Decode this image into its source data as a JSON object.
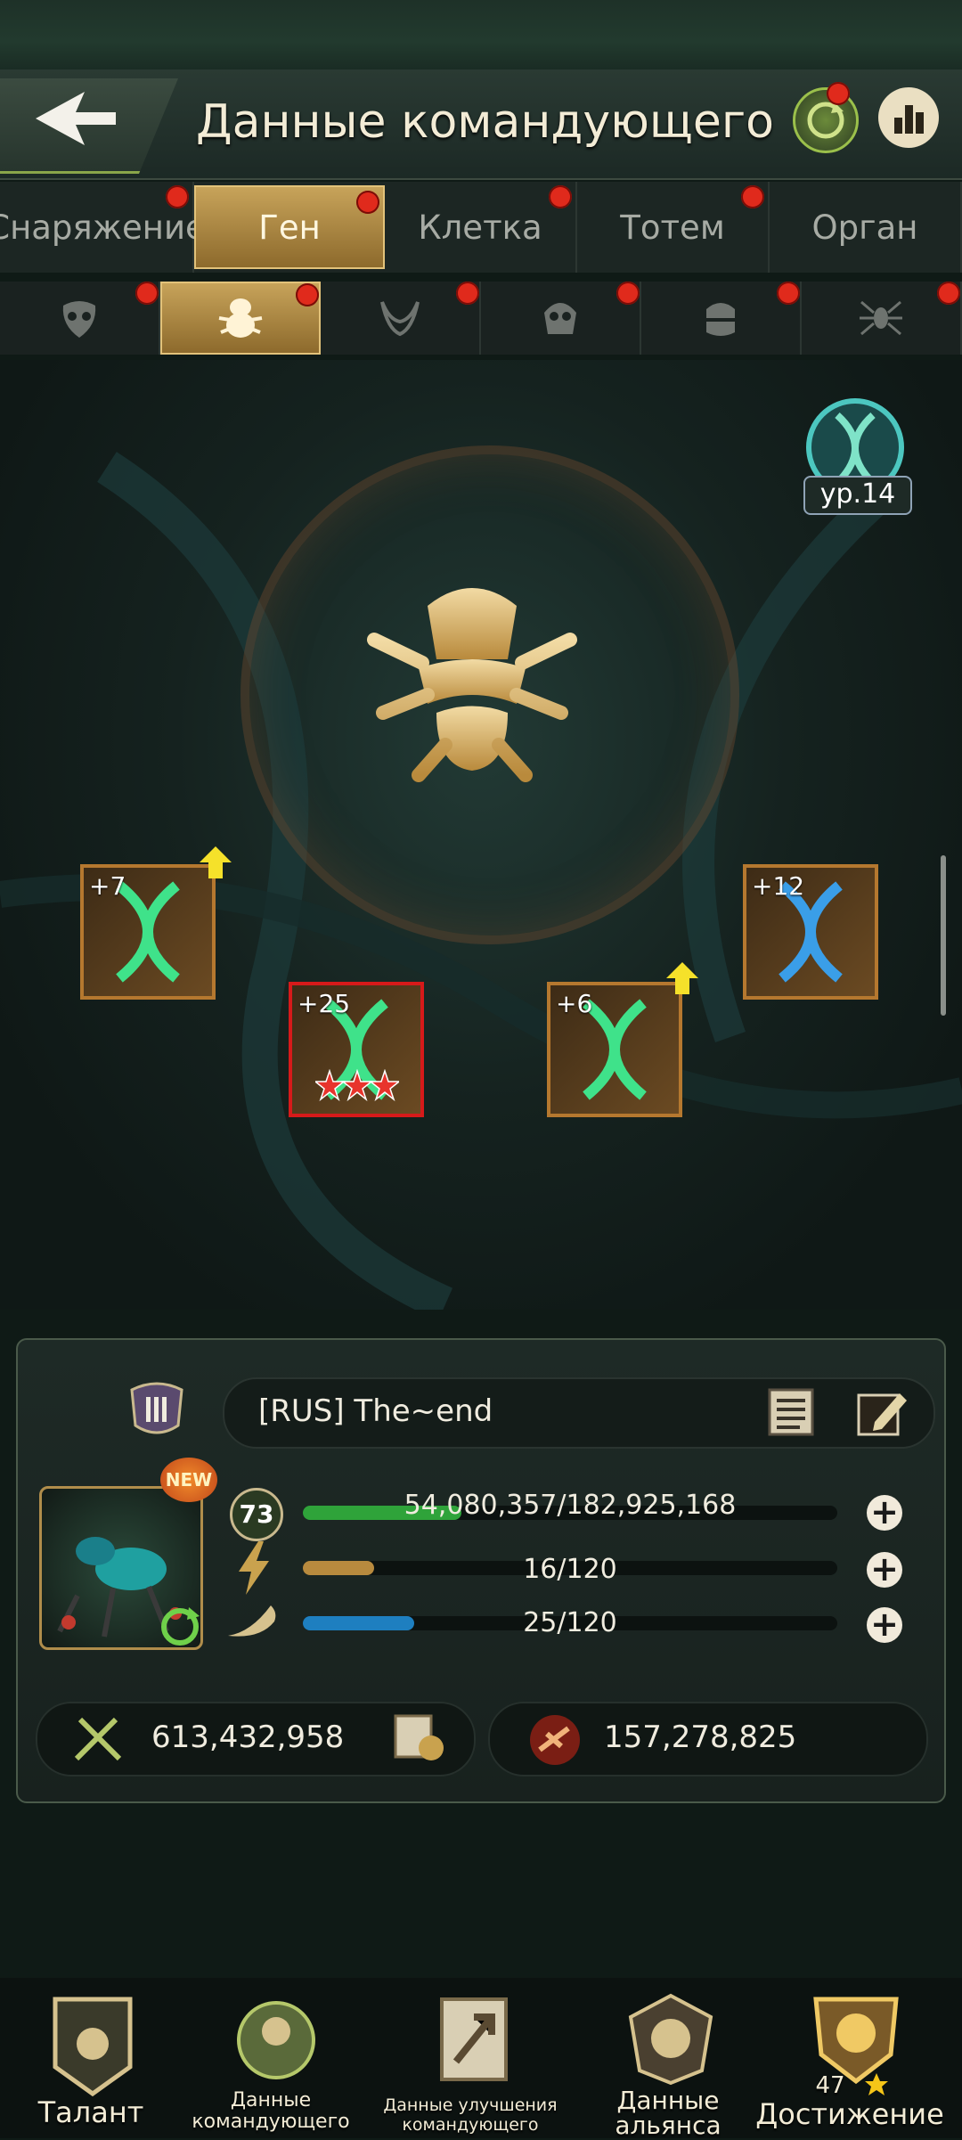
{
  "header": {
    "title": "Данные командующего"
  },
  "tabs": [
    {
      "label": "Снаряжение",
      "active": false
    },
    {
      "label": "Ген",
      "active": true
    },
    {
      "label": "Клетка",
      "active": false
    },
    {
      "label": "Тотем",
      "active": false
    },
    {
      "label": "Орган",
      "active": false
    }
  ],
  "sub_tabs": [
    {
      "icon": "mask-icon",
      "active": false
    },
    {
      "icon": "beetle-icon",
      "active": true
    },
    {
      "icon": "horns-icon",
      "active": false
    },
    {
      "icon": "skull-icon",
      "active": false
    },
    {
      "icon": "helmet-icon",
      "active": false
    },
    {
      "icon": "spider-icon",
      "active": false
    }
  ],
  "gene": {
    "level_label": "ур.14",
    "slots": [
      {
        "bonus": "+7",
        "color": "green",
        "upgrade": true,
        "stars": 0
      },
      {
        "bonus": "+25",
        "color": "green",
        "upgrade": false,
        "stars": 3
      },
      {
        "bonus": "+6",
        "color": "green",
        "upgrade": true,
        "stars": 0
      },
      {
        "bonus": "+12",
        "color": "blue",
        "upgrade": false,
        "stars": 0
      }
    ]
  },
  "profile": {
    "name": "[RUS]   The~end",
    "badge_new": "NEW",
    "level": "73",
    "stats": [
      {
        "icon": "level-leaf-icon",
        "text": "54,080,357/182,925,168",
        "fill": 0.296,
        "color": "#2fa33a"
      },
      {
        "icon": "lightning-icon",
        "text": "16/120",
        "fill": 0.133,
        "color": "#b88a3e"
      },
      {
        "icon": "horn-icon",
        "text": "25/120",
        "fill": 0.208,
        "color": "#1e7fc0"
      }
    ],
    "power": "613,432,958",
    "kills": "157,278,825"
  },
  "bottom_nav": [
    {
      "label": "Талант"
    },
    {
      "label": "Данные командующего"
    },
    {
      "label": "Данные улучшения командующего"
    },
    {
      "label": "Данные альянса"
    },
    {
      "label": "Достижение",
      "count": "47"
    }
  ],
  "colors": {
    "accent_gold": "#c7a35a",
    "dot_red": "#e02a1c"
  }
}
